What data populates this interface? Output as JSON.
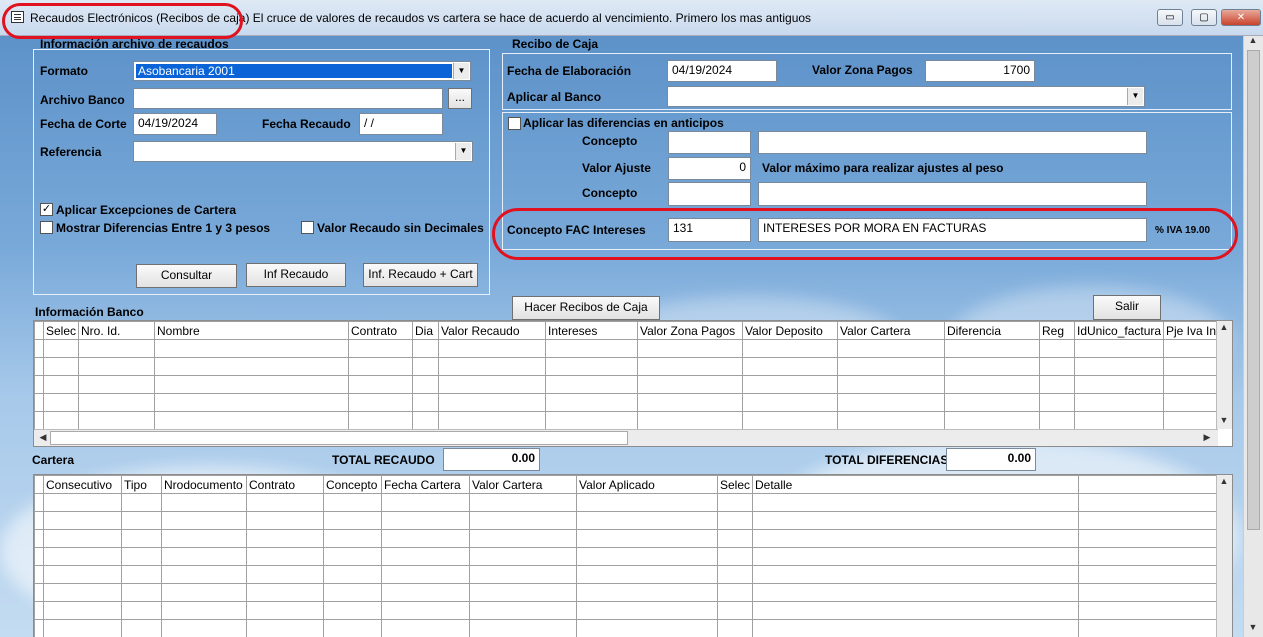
{
  "window": {
    "title": "Recaudos Electrónicos (Recibos de caja) El  cruce de valores de recaudos vs cartera se hace de acuerdo al vencimiento. Primero los mas antiguos",
    "controls": {
      "minimize": "▭",
      "maximize": "▢",
      "close": "✕"
    }
  },
  "recaudos": {
    "section_title": "Información archivo de recaudos",
    "formato_label": "Formato",
    "formato_value": "Asobancaria 2001",
    "archivo_label": "Archivo Banco",
    "archivo_value": "",
    "browse_label": "...",
    "fecha_corte_label": "Fecha de Corte",
    "fecha_corte_value": "04/19/2024",
    "fecha_recaudo_label": "Fecha Recaudo",
    "fecha_recaudo_value": " / /",
    "referencia_label": "Referencia",
    "referencia_value": "",
    "chk_excepciones_label": "Aplicar Excepciones de Cartera",
    "chk_excepciones_checked": true,
    "chk_diferencias_label": "Mostrar Diferencias Entre 1 y 3 pesos",
    "chk_diferencias_checked": false,
    "chk_sin_decimales_label": "Valor Recaudo sin Decimales",
    "chk_sin_decimales_checked": false,
    "consultar_label": "Consultar",
    "inf_recaudo_label": "Inf Recaudo",
    "inf_recaudo_cart_label": "Inf. Recaudo + Cart"
  },
  "recibo": {
    "section_title": "Recibo de Caja",
    "fecha_elab_label": "Fecha de Elaboración",
    "fecha_elab_value": "04/19/2024",
    "valor_zona_label": "Valor Zona Pagos",
    "valor_zona_value": "1700",
    "aplicar_banco_label": "Aplicar al Banco",
    "aplicar_banco_value": "",
    "chk_anticipos_label": "Aplicar las diferencias en anticipos",
    "concepto1_label": "Concepto",
    "concepto1_code": "",
    "concepto1_desc": "",
    "valor_ajuste_label": "Valor Ajuste",
    "valor_ajuste_value": "0",
    "valor_ajuste_note": "Valor máximo para realizar ajustes al peso",
    "concepto2_label": "Concepto",
    "concepto2_code": "",
    "concepto2_desc": "",
    "concepto_fac_label": "Concepto FAC Intereses",
    "concepto_fac_code": "131",
    "concepto_fac_desc": "INTERESES POR MORA EN FACTURAS",
    "iva_label": "% IVA 19.00"
  },
  "actions": {
    "hacer_recibos_label": "Hacer Recibos de Caja",
    "salir_label": "Salir"
  },
  "banco": {
    "section_title": "Información Banco",
    "columns": [
      "Selec",
      "Nro. Id.",
      "Nombre",
      "Contrato",
      "Dia",
      "Valor Recaudo",
      "Intereses",
      "Valor Zona Pagos",
      "Valor Deposito",
      "Valor Cartera",
      "Diferencia",
      "Reg",
      "IdUnico_factura",
      "Pje Iva Int"
    ]
  },
  "cartera": {
    "section_title": "Cartera",
    "total_recaudo_label": "TOTAL RECAUDO",
    "total_recaudo_value": "0.00",
    "total_dif_label": "TOTAL DIFERENCIAS",
    "total_dif_value": "0.00",
    "columns": [
      "Consecutivo",
      "Tipo",
      "Nrodocumento",
      "Contrato",
      "Concepto",
      "Fecha Cartera",
      "Valor Cartera",
      "Valor Aplicado",
      "Selec",
      "Detalle"
    ]
  },
  "colors": {
    "highlight_red": "#e0121f",
    "selection_blue": "#0a64d8"
  }
}
